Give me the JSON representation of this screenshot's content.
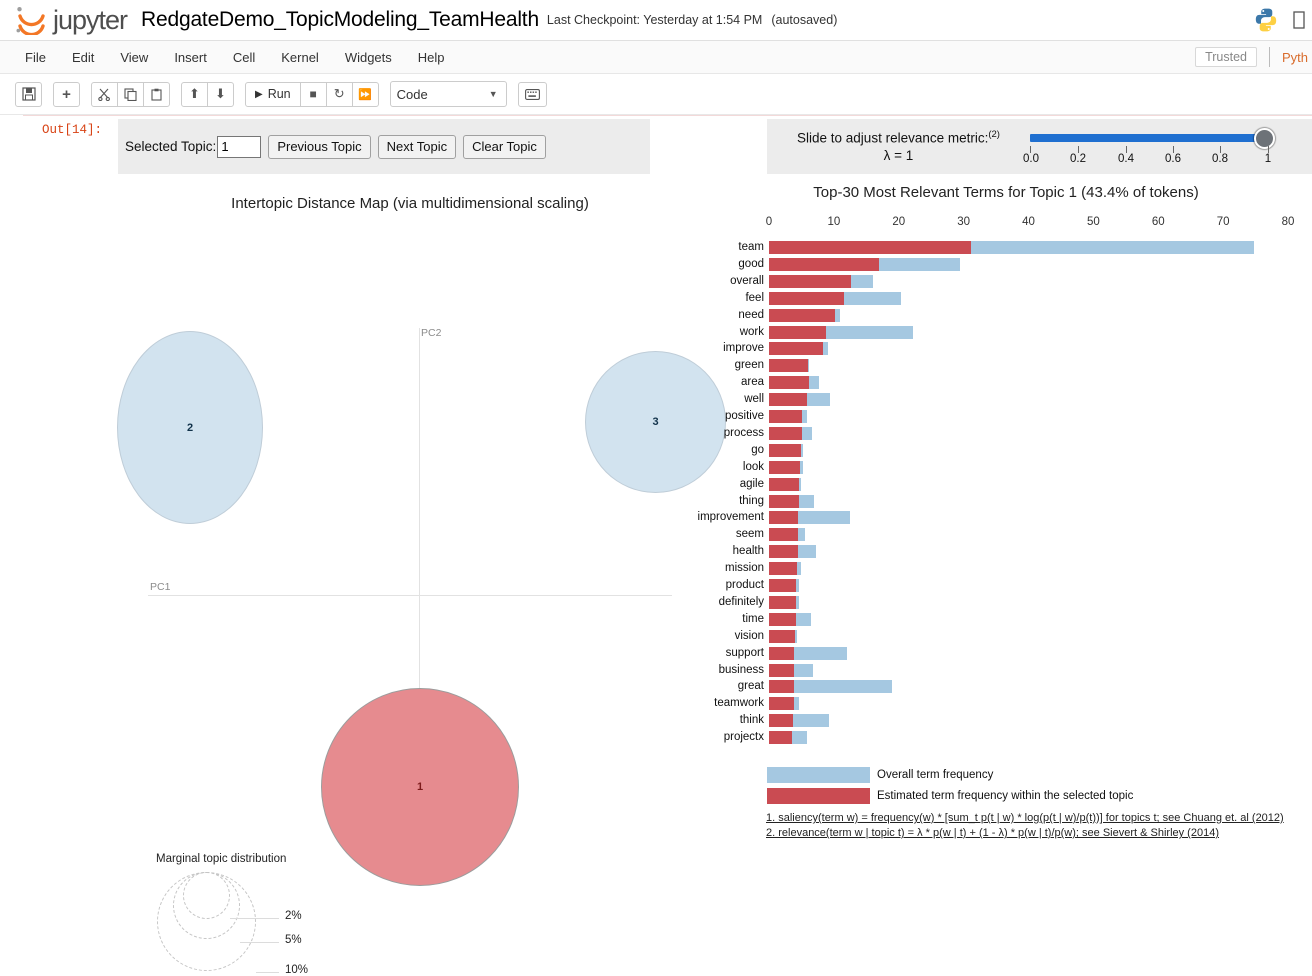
{
  "header": {
    "logo_text": "jupyter",
    "notebook_title": "RedgateDemo_TopicModeling_TeamHealth",
    "checkpoint": "Last Checkpoint: Yesterday at 1:54 PM",
    "autosaved": "(autosaved)",
    "logo_icon": "jupyter-logo-icon",
    "kernel_icon": "python-logo-icon"
  },
  "menubar": {
    "items": [
      "File",
      "Edit",
      "View",
      "Insert",
      "Cell",
      "Kernel",
      "Widgets",
      "Help"
    ],
    "trusted_label": "Trusted",
    "kernel_name": "Pyth"
  },
  "toolbar": {
    "save_icon": "save-disk-icon",
    "add_icon": "plus-icon",
    "cut_icon": "scissors-icon",
    "copy_icon": "copy-icon",
    "paste_icon": "paste-icon",
    "move_up_icon": "arrow-up-icon",
    "move_down_icon": "arrow-down-icon",
    "run_label": "Run",
    "run_icon": "play-icon",
    "stop_icon": "stop-square-icon",
    "restart_icon": "restart-circle-icon",
    "fastforward_icon": "fast-forward-icon",
    "celltype_value": "Code",
    "celltype_chevron": "chevron-down-icon",
    "keyboard_icon": "keyboard-icon"
  },
  "cell": {
    "output_prompt": "Out[14]:"
  },
  "topic_panel": {
    "label": "Selected Topic:",
    "input_value": "1",
    "previous_label": "Previous Topic",
    "next_label": "Next Topic",
    "clear_label": "Clear Topic"
  },
  "slider_panel": {
    "label": "Slide to adjust relevance metric:",
    "superscript": "(2)",
    "lambda_text": "λ = 1",
    "ticks": [
      "0.0",
      "0.2",
      "0.4",
      "0.6",
      "0.8",
      "1"
    ],
    "value": 1
  },
  "map": {
    "title": "Intertopic Distance Map (via multidimensional scaling)",
    "x_axis_label": "PC1",
    "y_axis_label": "PC2",
    "marginal_title": "Marginal topic distribution",
    "marginal_labels": [
      "2%",
      "5%",
      "10%"
    ]
  },
  "legend": {
    "overall_label": "Overall term frequency",
    "estimated_label": "Estimated term frequency within the selected topic",
    "overall_color": "#a5c8e1",
    "estimated_color": "#ca4b52",
    "footnote1": "1. saliency(term w) = frequency(w) * [sum_t p(t | w) * log(p(t | w)/p(t))] for topics t; see Chuang et. al (2012)",
    "footnote2": "2. relevance(term w | topic t) = λ * p(w | t) + (1 - λ) * p(w | t)/p(w); see Sievert & Shirley (2014)"
  },
  "chart_data": [
    {
      "type": "scatter",
      "title": "Intertopic Distance Map (via multidimensional scaling)",
      "xlabel": "PC1",
      "ylabel": "PC2",
      "grid": false,
      "legend": "none",
      "points": [
        {
          "label": "1",
          "x": 0.0,
          "y": -0.3,
          "size_pct": 43.4,
          "color": "#e68b8f",
          "selected": true
        },
        {
          "label": "2",
          "x": -0.57,
          "y": 0.3,
          "size_pct": 30.0,
          "color": "#d2e3ef",
          "selected": false
        },
        {
          "label": "3",
          "x": 0.48,
          "y": 0.33,
          "size_pct": 26.6,
          "color": "#d2e3ef",
          "selected": false
        }
      ]
    },
    {
      "type": "bar",
      "orientation": "horizontal",
      "title": "Top-30 Most Relevant Terms for Topic 1 (43.4% of tokens)",
      "xlabel": "",
      "ylabel": "",
      "xlim": [
        0,
        80
      ],
      "xticks": [
        0,
        10,
        20,
        30,
        40,
        50,
        60,
        70,
        80
      ],
      "grid": false,
      "legend_position": "bottom",
      "categories": [
        "team",
        "good",
        "overall",
        "feel",
        "need",
        "work",
        "improve",
        "green",
        "area",
        "well",
        "positive",
        "process",
        "go",
        "look",
        "agile",
        "thing",
        "improvement",
        "seem",
        "health",
        "mission",
        "product",
        "definitely",
        "time",
        "vision",
        "support",
        "business",
        "great",
        "teamwork",
        "think",
        "projectx"
      ],
      "series": [
        {
          "name": "Overall term frequency",
          "color": "#a5c8e1",
          "values": [
            74.8,
            29.4,
            16.1,
            20.3,
            11.0,
            22.2,
            9.1,
            6.2,
            7.7,
            9.4,
            5.9,
            6.6,
            5.3,
            5.3,
            5.0,
            7.0,
            12.5,
            5.5,
            7.3,
            5.0,
            4.7,
            4.7,
            6.5,
            4.3,
            12.1,
            6.8,
            19.0,
            4.6,
            9.2,
            5.8
          ]
        },
        {
          "name": "Estimated term frequency within the selected topic",
          "color": "#ca4b52",
          "values": [
            31.2,
            16.9,
            12.6,
            11.6,
            10.2,
            8.8,
            8.4,
            6.0,
            6.1,
            5.9,
            5.1,
            5.1,
            4.9,
            4.8,
            4.6,
            4.6,
            4.5,
            4.5,
            4.4,
            4.3,
            4.2,
            4.2,
            4.1,
            4.0,
            3.9,
            3.9,
            3.8,
            3.8,
            3.7,
            3.6
          ]
        }
      ]
    }
  ]
}
